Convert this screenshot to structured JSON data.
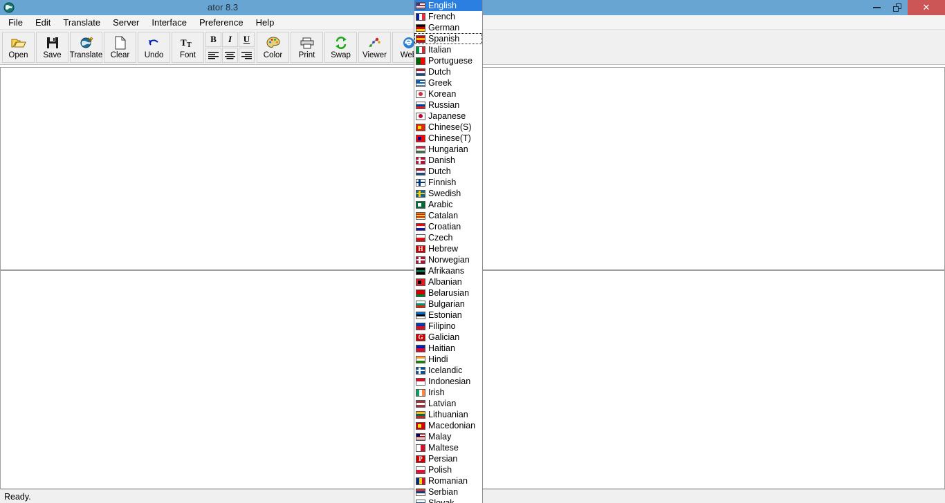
{
  "window": {
    "title_visible": "ator 8.3",
    "icon": "globe-icon",
    "minimize": "–",
    "restore": "restore",
    "close": "✕",
    "titlebar_color": "#68a5d3",
    "close_color": "#cc5555"
  },
  "menubar": {
    "items": [
      {
        "label": "File"
      },
      {
        "label": "Edit"
      },
      {
        "label": "Translate"
      },
      {
        "label": "Server"
      },
      {
        "label": "Interface"
      },
      {
        "label": "Preference"
      },
      {
        "label": "Help"
      }
    ]
  },
  "toolbar": {
    "buttons": [
      {
        "label": "Open",
        "icon": "open-folder-icon"
      },
      {
        "label": "Save",
        "icon": "floppy-disk-icon"
      },
      {
        "label": "Translate",
        "icon": "globe-pencil-icon"
      },
      {
        "label": "Clear",
        "icon": "blank-page-icon"
      },
      {
        "label": "Undo",
        "icon": "undo-arrow-icon"
      },
      {
        "label": "Font",
        "icon": "font-tt-icon"
      }
    ],
    "format_buttons": [
      {
        "label": "B",
        "icon": "bold-icon"
      },
      {
        "label": "I",
        "icon": "italic-icon"
      },
      {
        "label": "U",
        "icon": "underline-icon"
      },
      {
        "label": "",
        "icon": "align-left-icon"
      },
      {
        "label": "",
        "icon": "align-center-icon"
      },
      {
        "label": "",
        "icon": "align-right-icon"
      }
    ],
    "buttons_right": [
      {
        "label": "Color",
        "icon": "palette-icon"
      },
      {
        "label": "Print",
        "icon": "printer-icon"
      },
      {
        "label": "Swap",
        "icon": "swap-arrows-icon"
      },
      {
        "label": "Viewer",
        "icon": "viewer-icon"
      },
      {
        "label": "Web",
        "icon": "browser-e-icon"
      }
    ]
  },
  "editor": {
    "source_text": "",
    "target_text": ""
  },
  "statusbar": {
    "text": "Ready."
  },
  "language_dropdown": {
    "selected": "English",
    "focused": "Spanish",
    "items": [
      {
        "label": "English",
        "flag": "flag-us",
        "type": "stripes",
        "colors": [
          "#b22234",
          "#ffffff",
          "#b22234",
          "#ffffff",
          "#b22234"
        ],
        "canton": "#3c3b6e"
      },
      {
        "label": "French",
        "flag": "flag-fr",
        "type": "vertical",
        "colors": [
          "#002395",
          "#ffffff",
          "#ed2939"
        ]
      },
      {
        "label": "German",
        "flag": "flag-de",
        "type": "horizontal",
        "colors": [
          "#000000",
          "#dd0000",
          "#ffce00"
        ]
      },
      {
        "label": "Spanish",
        "flag": "flag-es",
        "type": "horizontal",
        "colors": [
          "#c60b1e",
          "#ffc400",
          "#c60b1e"
        ]
      },
      {
        "label": "Italian",
        "flag": "flag-it",
        "type": "vertical",
        "colors": [
          "#009246",
          "#ffffff",
          "#ce2b37"
        ]
      },
      {
        "label": "Portuguese",
        "flag": "flag-pt",
        "type": "vertical2",
        "colors": [
          "#006600",
          "#ff0000"
        ]
      },
      {
        "label": "Dutch",
        "flag": "flag-nl",
        "type": "horizontal",
        "colors": [
          "#ae1c28",
          "#ffffff",
          "#21468b"
        ]
      },
      {
        "label": "Greek",
        "flag": "flag-gr",
        "type": "stripes",
        "colors": [
          "#0d5eaf",
          "#ffffff",
          "#0d5eaf",
          "#ffffff",
          "#0d5eaf"
        ],
        "canton": "#0d5eaf"
      },
      {
        "label": "Korean",
        "flag": "flag-kr",
        "type": "circle",
        "colors": [
          "#ffffff"
        ],
        "accent": "#cd2e3a"
      },
      {
        "label": "Russian",
        "flag": "flag-ru",
        "type": "horizontal",
        "colors": [
          "#ffffff",
          "#0039a6",
          "#d52b1e"
        ]
      },
      {
        "label": "Japanese",
        "flag": "flag-jp",
        "type": "circle",
        "colors": [
          "#ffffff"
        ],
        "accent": "#bc002d"
      },
      {
        "label": "Chinese(S)",
        "flag": "flag-cn",
        "type": "solid",
        "colors": [
          "#de2910"
        ],
        "accent": "#ffde00"
      },
      {
        "label": "Chinese(T)",
        "flag": "flag-tw",
        "type": "solid",
        "colors": [
          "#fe0000"
        ],
        "accent": "#000095"
      },
      {
        "label": "Hungarian",
        "flag": "flag-hu",
        "type": "horizontal",
        "colors": [
          "#cd2a3e",
          "#ffffff",
          "#436f4d"
        ]
      },
      {
        "label": "Danish",
        "flag": "flag-dk",
        "type": "cross",
        "colors": [
          "#c60c30"
        ],
        "accent": "#ffffff"
      },
      {
        "label": "Dutch",
        "flag": "flag-nl",
        "type": "horizontal",
        "colors": [
          "#ae1c28",
          "#ffffff",
          "#21468b"
        ]
      },
      {
        "label": "Finnish",
        "flag": "flag-fi",
        "type": "cross",
        "colors": [
          "#ffffff"
        ],
        "accent": "#003580"
      },
      {
        "label": "Swedish",
        "flag": "flag-se",
        "type": "cross",
        "colors": [
          "#006aa7"
        ],
        "accent": "#fecc00"
      },
      {
        "label": "Arabic",
        "flag": "flag-sa",
        "type": "solid",
        "colors": [
          "#006c35"
        ],
        "accent": "#ffffff"
      },
      {
        "label": "Catalan",
        "flag": "flag-cat",
        "type": "stripes",
        "colors": [
          "#fcdd09",
          "#da121a",
          "#fcdd09",
          "#da121a",
          "#fcdd09"
        ]
      },
      {
        "label": "Croatian",
        "flag": "flag-hr",
        "type": "horizontal",
        "colors": [
          "#ff0000",
          "#ffffff",
          "#171796"
        ]
      },
      {
        "label": "Czech",
        "flag": "flag-cz",
        "type": "horizontal2",
        "colors": [
          "#ffffff",
          "#d7141a"
        ],
        "accent": "#11457e"
      },
      {
        "label": "Hebrew",
        "flag": "flag-il",
        "type": "glyph",
        "colors": [
          "#cc0000"
        ],
        "glyph": "H"
      },
      {
        "label": "Norwegian",
        "flag": "flag-no",
        "type": "cross",
        "colors": [
          "#ba0c2f"
        ],
        "accent": "#ffffff"
      },
      {
        "label": "Afrikaans",
        "flag": "flag-za",
        "type": "horizontal",
        "colors": [
          "#000000",
          "#007a4d",
          "#000000"
        ],
        "accent": "#de3831"
      },
      {
        "label": "Albanian",
        "flag": "flag-al",
        "type": "solid",
        "colors": [
          "#e41e20"
        ],
        "accent": "#000000"
      },
      {
        "label": "Belarusian",
        "flag": "flag-by",
        "type": "horizontal",
        "colors": [
          "#cc0000",
          "#cc0000",
          "#007c30"
        ],
        "accent": "#ffffff"
      },
      {
        "label": "Bulgarian",
        "flag": "flag-bg",
        "type": "horizontal",
        "colors": [
          "#ffffff",
          "#00966e",
          "#d62612"
        ]
      },
      {
        "label": "Estonian",
        "flag": "flag-ee",
        "type": "horizontal",
        "colors": [
          "#0072ce",
          "#000000",
          "#ffffff"
        ]
      },
      {
        "label": "Filipino",
        "flag": "flag-ph",
        "type": "horizontal2",
        "colors": [
          "#0038a8",
          "#ce1126"
        ],
        "accent": "#ffffff"
      },
      {
        "label": "Galician",
        "flag": "flag-gl",
        "type": "glyph",
        "colors": [
          "#cc0000"
        ],
        "glyph": "G"
      },
      {
        "label": "Haitian",
        "flag": "flag-ht",
        "type": "horizontal2",
        "colors": [
          "#00209f",
          "#d21034"
        ]
      },
      {
        "label": "Hindi",
        "flag": "flag-in",
        "type": "horizontal",
        "colors": [
          "#ff9933",
          "#ffffff",
          "#138808"
        ]
      },
      {
        "label": "Icelandic",
        "flag": "flag-is",
        "type": "cross",
        "colors": [
          "#02529c"
        ],
        "accent": "#ffffff"
      },
      {
        "label": "Indonesian",
        "flag": "flag-id",
        "type": "horizontal2",
        "colors": [
          "#ce1126",
          "#ffffff"
        ]
      },
      {
        "label": "Irish",
        "flag": "flag-ie",
        "type": "vertical",
        "colors": [
          "#169b62",
          "#ffffff",
          "#ff883e"
        ]
      },
      {
        "label": "Latvian",
        "flag": "flag-lv",
        "type": "horizontal",
        "colors": [
          "#9e3039",
          "#ffffff",
          "#9e3039"
        ]
      },
      {
        "label": "Lithuanian",
        "flag": "flag-lt",
        "type": "horizontal",
        "colors": [
          "#fdb913",
          "#006a44",
          "#c1272d"
        ]
      },
      {
        "label": "Macedonian",
        "flag": "flag-mk",
        "type": "solid",
        "colors": [
          "#d20000"
        ],
        "accent": "#ffe600"
      },
      {
        "label": "Malay",
        "flag": "flag-my",
        "type": "stripes",
        "colors": [
          "#cc0001",
          "#ffffff",
          "#cc0001",
          "#ffffff",
          "#cc0001"
        ],
        "canton": "#010066"
      },
      {
        "label": "Maltese",
        "flag": "flag-mt",
        "type": "vertical2",
        "colors": [
          "#ffffff",
          "#cf142b"
        ]
      },
      {
        "label": "Persian",
        "flag": "flag-ir",
        "type": "glyph",
        "colors": [
          "#cc0000"
        ],
        "glyph": "P"
      },
      {
        "label": "Polish",
        "flag": "flag-pl",
        "type": "horizontal2",
        "colors": [
          "#ffffff",
          "#dc143c"
        ]
      },
      {
        "label": "Romanian",
        "flag": "flag-ro",
        "type": "vertical",
        "colors": [
          "#002b7f",
          "#fcd116",
          "#ce1126"
        ]
      },
      {
        "label": "Serbian",
        "flag": "flag-rs",
        "type": "horizontal",
        "colors": [
          "#c6363c",
          "#0c4076",
          "#ffffff"
        ]
      },
      {
        "label": "Slovak",
        "flag": "flag-sk",
        "type": "horizontal",
        "colors": [
          "#ffffff",
          "#0b4ea2",
          "#ee1c25"
        ]
      }
    ]
  }
}
